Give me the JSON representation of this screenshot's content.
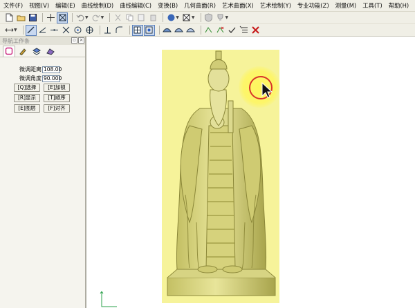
{
  "menus": [
    "文件(F)",
    "视图(V)",
    "编辑(E)",
    "曲线绘制(D)",
    "曲线编辑(C)",
    "变换(B)",
    "几何曲面(R)",
    "艺术曲面(X)",
    "艺术绘制(Y)",
    "专业功能(Z)",
    "测量(M)",
    "工具(T)",
    "帮助(H)"
  ],
  "panel": {
    "title": "导航工作条",
    "fields": [
      {
        "label": "微调距离",
        "value": "108.00"
      },
      {
        "label": "微调角度",
        "value": "90.000"
      }
    ],
    "buttons": [
      [
        "[Q]选择",
        "[E]加锁"
      ],
      [
        "[R]显示",
        "[T]顺序"
      ],
      [
        "[E]图层",
        "[F]对齐"
      ]
    ]
  },
  "colors": {
    "bbox": "#f6f39a",
    "model": "#d9d67a",
    "cursor_ring": "#d8352a"
  }
}
